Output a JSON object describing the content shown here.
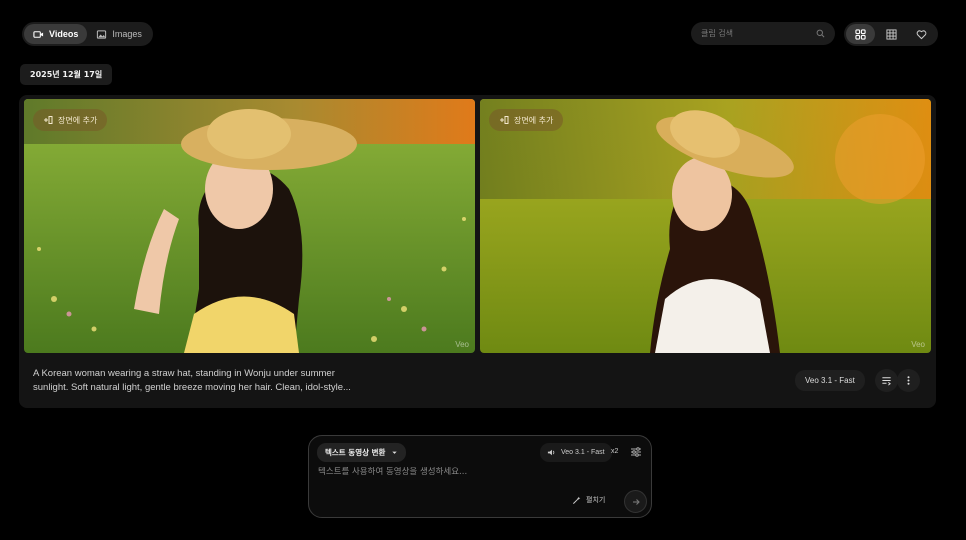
{
  "topbar": {
    "tabs": [
      {
        "label": "Videos",
        "icon": "video-icon",
        "active": true
      },
      {
        "label": "Images",
        "icon": "image-icon",
        "active": false
      }
    ],
    "search": {
      "placeholder": "클립 검색",
      "value": ""
    },
    "views": [
      {
        "icon": "grid-large-icon",
        "active": true
      },
      {
        "icon": "grid-small-icon",
        "active": false
      },
      {
        "icon": "heart-icon",
        "active": false
      }
    ]
  },
  "date_label": "2025년 12월 17일",
  "card": {
    "media": [
      {
        "add_scene_label": "장면에 추가",
        "watermark": "Veo"
      },
      {
        "add_scene_label": "장면에 추가",
        "watermark": "Veo"
      }
    ],
    "caption": "A Korean woman wearing a straw hat, standing in Wonju under summer sunlight. Soft natural light, gentle breeze moving her hair. Clean, idol-style...",
    "model": "Veo 3.1 - Fast"
  },
  "composer": {
    "mode_label": "텍스트 동영상 변환",
    "model_label": "Veo 3.1 - Fast",
    "count_label": "x2",
    "prompt_placeholder": "텍스트를 사용하여 동영상을 생성하세요...",
    "expand_label": "펼치기"
  },
  "colors": {
    "background": "#000000",
    "surface": "#141414",
    "chip": "#1c1c1c",
    "active": "#3a3a3a"
  }
}
